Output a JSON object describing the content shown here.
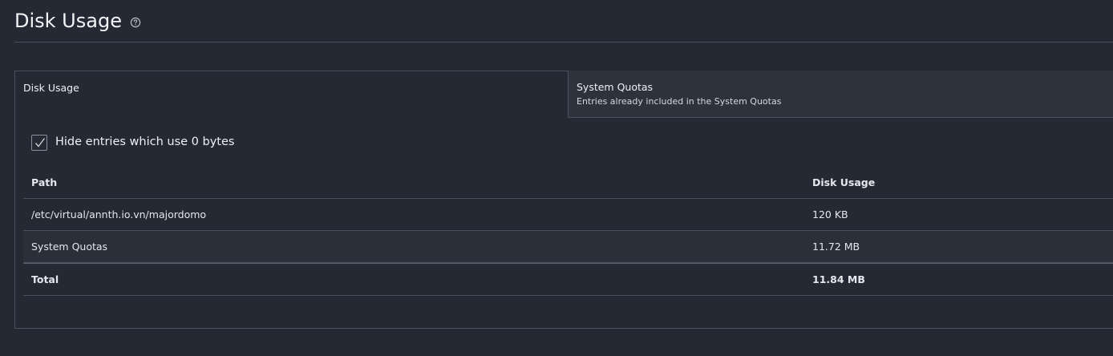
{
  "header": {
    "title": "Disk Usage",
    "help_icon": "question-circle-icon"
  },
  "tabs": [
    {
      "label": "Disk Usage",
      "subtitle": ""
    },
    {
      "label": "System Quotas",
      "subtitle": "Entries already included in the System Quotas"
    }
  ],
  "filter": {
    "hide_zero_label": "Hide entries which use 0 bytes",
    "checked": true
  },
  "table": {
    "columns": [
      "Path",
      "Disk Usage"
    ],
    "rows": [
      {
        "path": "/etc/virtual/annth.io.vn/majordomo",
        "usage": "120 KB"
      },
      {
        "path": "System Quotas",
        "usage": "11.72 MB"
      }
    ],
    "total": {
      "label": "Total",
      "usage": "11.84 MB"
    }
  },
  "colors": {
    "background": "#252933",
    "panel_alt": "#2d323c",
    "border": "#4a505c",
    "text": "#e4e7ec"
  }
}
